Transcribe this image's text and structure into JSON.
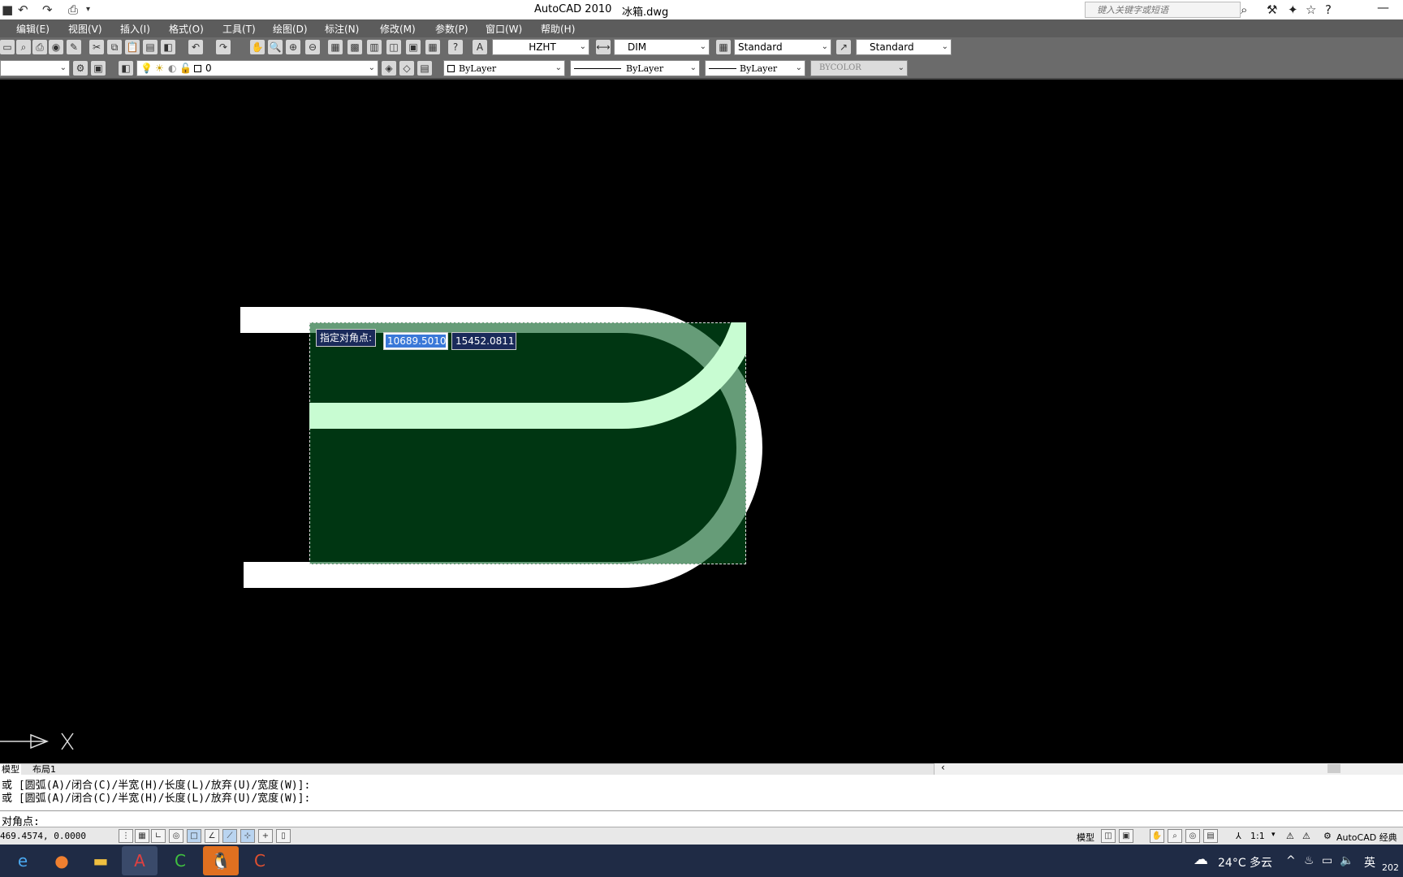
{
  "window": {
    "title": "AutoCAD 2010",
    "filename": "冰箱.dwg",
    "search_placeholder": "键入关键字或短语"
  },
  "menu": [
    "编辑(E)",
    "视图(V)",
    "插入(I)",
    "格式(O)",
    "工具(T)",
    "绘图(D)",
    "标注(N)",
    "修改(M)",
    "参数(P)",
    "窗口(W)",
    "帮助(H)"
  ],
  "toolbar1": {
    "text_style": "HZHT",
    "dim_style": "DIM",
    "table_style": "Standard",
    "multileader_style": "Standard"
  },
  "toolbar2": {
    "layer": "0",
    "color": "ByLayer",
    "linetype": "ByLayer",
    "lineweight": "ByLayer",
    "plotstyle": "BYCOLOR"
  },
  "drawing": {
    "prompt_label": "指定对角点:",
    "coord_x": "10689.5010",
    "coord_y": "15452.0811",
    "selection_color": "#00501e",
    "shape_color": "#ffffff",
    "highlight_color": "#c8fcd2"
  },
  "tabs": [
    "模型",
    "布局1"
  ],
  "command": {
    "line1": "或 [圆弧(A)/闭合(C)/半宽(H)/长度(L)/放弃(U)/宽度(W)]:",
    "line2": "或 [圆弧(A)/闭合(C)/半宽(H)/长度(L)/放弃(U)/宽度(W)]:",
    "prompt": "对角点:"
  },
  "status": {
    "coords": "469.4574, 0.0000",
    "model_label": "模型",
    "scale": "1:1",
    "workspace": "AutoCAD 经典"
  },
  "taskbar": {
    "weather": "24°C 多云",
    "ime": "英",
    "clock_partial": "202"
  }
}
